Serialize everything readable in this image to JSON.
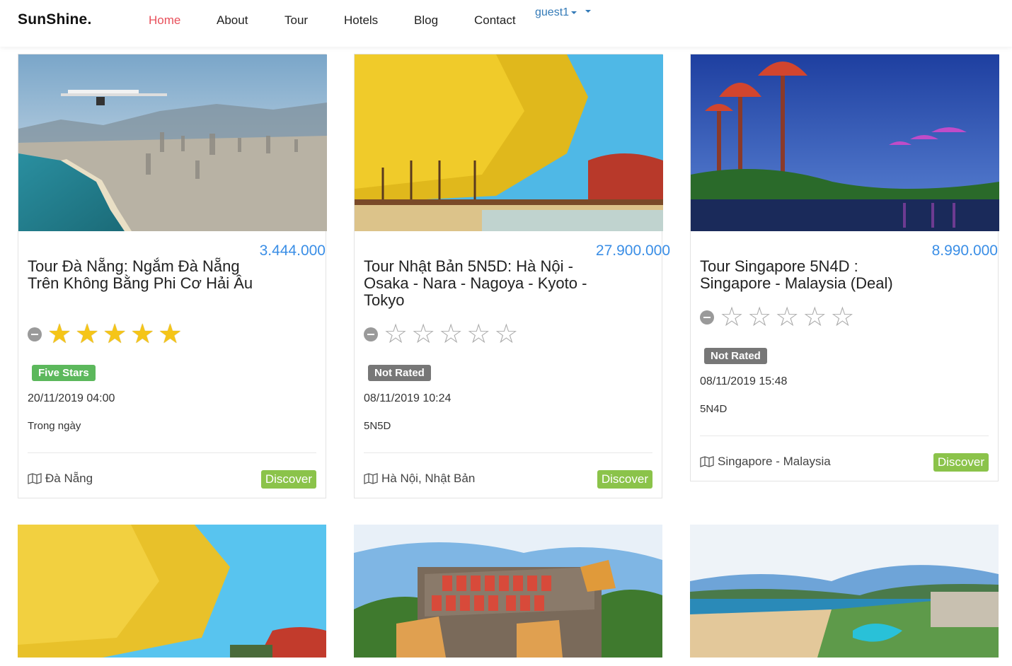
{
  "brand": "SunShine.",
  "nav": [
    {
      "label": "Home",
      "active": true
    },
    {
      "label": "About"
    },
    {
      "label": "Tour"
    },
    {
      "label": "Hotels"
    },
    {
      "label": "Blog"
    },
    {
      "label": "Contact"
    }
  ],
  "user": "guest1",
  "cards": [
    {
      "price": "3.444.000",
      "title": "Tour Đà Nẵng: Ngắm Đà Nẵng Trên Không Bằng Phi Cơ Hải Âu",
      "stars": 5,
      "badge": "Five Stars",
      "date": "20/11/2019 04:00",
      "duration": "Trong ngày",
      "location": "Đà Nẵng",
      "button": "Discover"
    },
    {
      "price": "27.900.000",
      "title": "Tour Nhật Bản 5N5D: Hà Nội - Osaka - Nara - Nagoya - Kyoto - Tokyo",
      "stars": 0,
      "badge": "Not Rated",
      "date": "08/11/2019 10:24",
      "duration": "5N5D",
      "location": "Hà Nội, Nhật Bản",
      "button": "Discover"
    },
    {
      "price": "8.990.000",
      "title": "Tour Singapore 5N4D : Singapore - Malaysia (Deal)",
      "stars": 0,
      "badge": "Not Rated",
      "date": "08/11/2019 15:48",
      "duration": "5N4D",
      "location": "Singapore - Malaysia",
      "button": "Discover"
    }
  ],
  "colors": {
    "accent": "#e8505b",
    "price": "#3a8ee6",
    "badge_green": "#5cb85c",
    "badge_gray": "#777777",
    "discover": "#8bc34a",
    "link": "#337ab7"
  }
}
